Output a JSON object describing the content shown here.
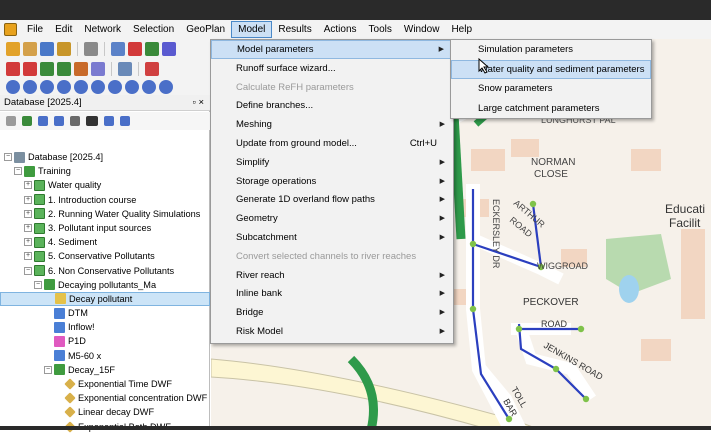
{
  "menubar": {
    "items": [
      "File",
      "Edit",
      "Network",
      "Selection",
      "GeoPlan",
      "Model",
      "Results",
      "Actions",
      "Tools",
      "Window",
      "Help"
    ],
    "active_index": 5
  },
  "database_panel": {
    "title": "Database [2025.4]",
    "close_glyph": "▫ ×"
  },
  "tree": [
    {
      "label": "Database [2025.4]",
      "indent": 0,
      "icon": "db",
      "expander": "−"
    },
    {
      "label": "Training",
      "indent": 1,
      "icon": "green",
      "expander": "−"
    },
    {
      "label": "Water quality",
      "indent": 2,
      "icon": "folder",
      "expander": "+"
    },
    {
      "label": "1. Introduction course",
      "indent": 2,
      "icon": "folder",
      "expander": "+"
    },
    {
      "label": "2. Running Water Quality Simulations",
      "indent": 2,
      "icon": "folder",
      "expander": "+"
    },
    {
      "label": "3. Pollutant input sources",
      "indent": 2,
      "icon": "folder",
      "expander": "+"
    },
    {
      "label": "4. Sediment",
      "indent": 2,
      "icon": "folder",
      "expander": "+"
    },
    {
      "label": "5. Conservative Pollutants",
      "indent": 2,
      "icon": "folder",
      "expander": "+"
    },
    {
      "label": "6. Non Conservative Pollutants",
      "indent": 2,
      "icon": "folder",
      "expander": "−"
    },
    {
      "label": "Decaying pollutants_Ma",
      "indent": 3,
      "icon": "green",
      "expander": "−"
    },
    {
      "label": "Decay pollutant",
      "indent": 4,
      "icon": "yellow",
      "expander": "",
      "selected": true
    },
    {
      "label": "DTM",
      "indent": 4,
      "icon": "blue",
      "expander": ""
    },
    {
      "label": "Inflow!",
      "indent": 4,
      "icon": "blue",
      "expander": ""
    },
    {
      "label": "P1D",
      "indent": 4,
      "icon": "pink",
      "expander": ""
    },
    {
      "label": "M5-60 x",
      "indent": 4,
      "icon": "blue",
      "expander": ""
    },
    {
      "label": "Decay_15F",
      "indent": 4,
      "icon": "green",
      "expander": "−"
    },
    {
      "label": "Exponential Time DWF",
      "indent": 5,
      "icon": "diamond",
      "expander": ""
    },
    {
      "label": "Exponential concentration DWF",
      "indent": 5,
      "icon": "diamond",
      "expander": ""
    },
    {
      "label": "Linear decay DWF",
      "indent": 5,
      "icon": "diamond",
      "expander": ""
    },
    {
      "label": "Exponential Both DWF",
      "indent": 5,
      "icon": "diamond",
      "expander": ""
    }
  ],
  "model_menu": [
    {
      "label": "Model parameters",
      "arrow": true,
      "highlight": true
    },
    {
      "label": "Runoff surface wizard..."
    },
    {
      "label": "Calculate ReFH parameters",
      "disabled": true
    },
    {
      "label": "Define branches..."
    },
    {
      "label": "Meshing",
      "arrow": true
    },
    {
      "label": "Update from ground model...",
      "shortcut": "Ctrl+U"
    },
    {
      "label": "Simplify",
      "arrow": true
    },
    {
      "label": "Storage operations",
      "arrow": true
    },
    {
      "label": "Generate 1D overland flow paths",
      "arrow": true
    },
    {
      "label": "Geometry",
      "arrow": true
    },
    {
      "label": "Subcatchment",
      "arrow": true
    },
    {
      "label": "Convert selected channels to river reaches",
      "disabled": true
    },
    {
      "label": "River reach",
      "arrow": true
    },
    {
      "label": "Inline bank",
      "arrow": true
    },
    {
      "label": "Bridge",
      "arrow": true
    },
    {
      "label": "Risk Model",
      "arrow": true
    }
  ],
  "submenu": [
    {
      "label": "Simulation parameters"
    },
    {
      "label": "Water quality and sediment parameters",
      "highlight": true
    },
    {
      "label": "Snow parameters"
    },
    {
      "label": "Large catchment parameters"
    }
  ],
  "map_labels": {
    "street1": "NORMAN",
    "street1b": "CLOSE",
    "street2": "ECKERSLEY DR",
    "street3": "ARTHUR",
    "street3b": "ROAD",
    "street4": "WIGGROAD",
    "street5": "PECKOVER",
    "street5b": "ROAD",
    "street6": "JENKINS ROAD",
    "street7": "TOLL",
    "street7b": "BAR",
    "poi1": "Educati",
    "poi1b": "Facilit",
    "street8": "LUNGHURST PAL"
  },
  "colors": {
    "menu_highlight": "#cce0f5",
    "pipe": "#2b3fbf",
    "green_channel": "#2e9a4a",
    "road": "#fdf6d3"
  }
}
